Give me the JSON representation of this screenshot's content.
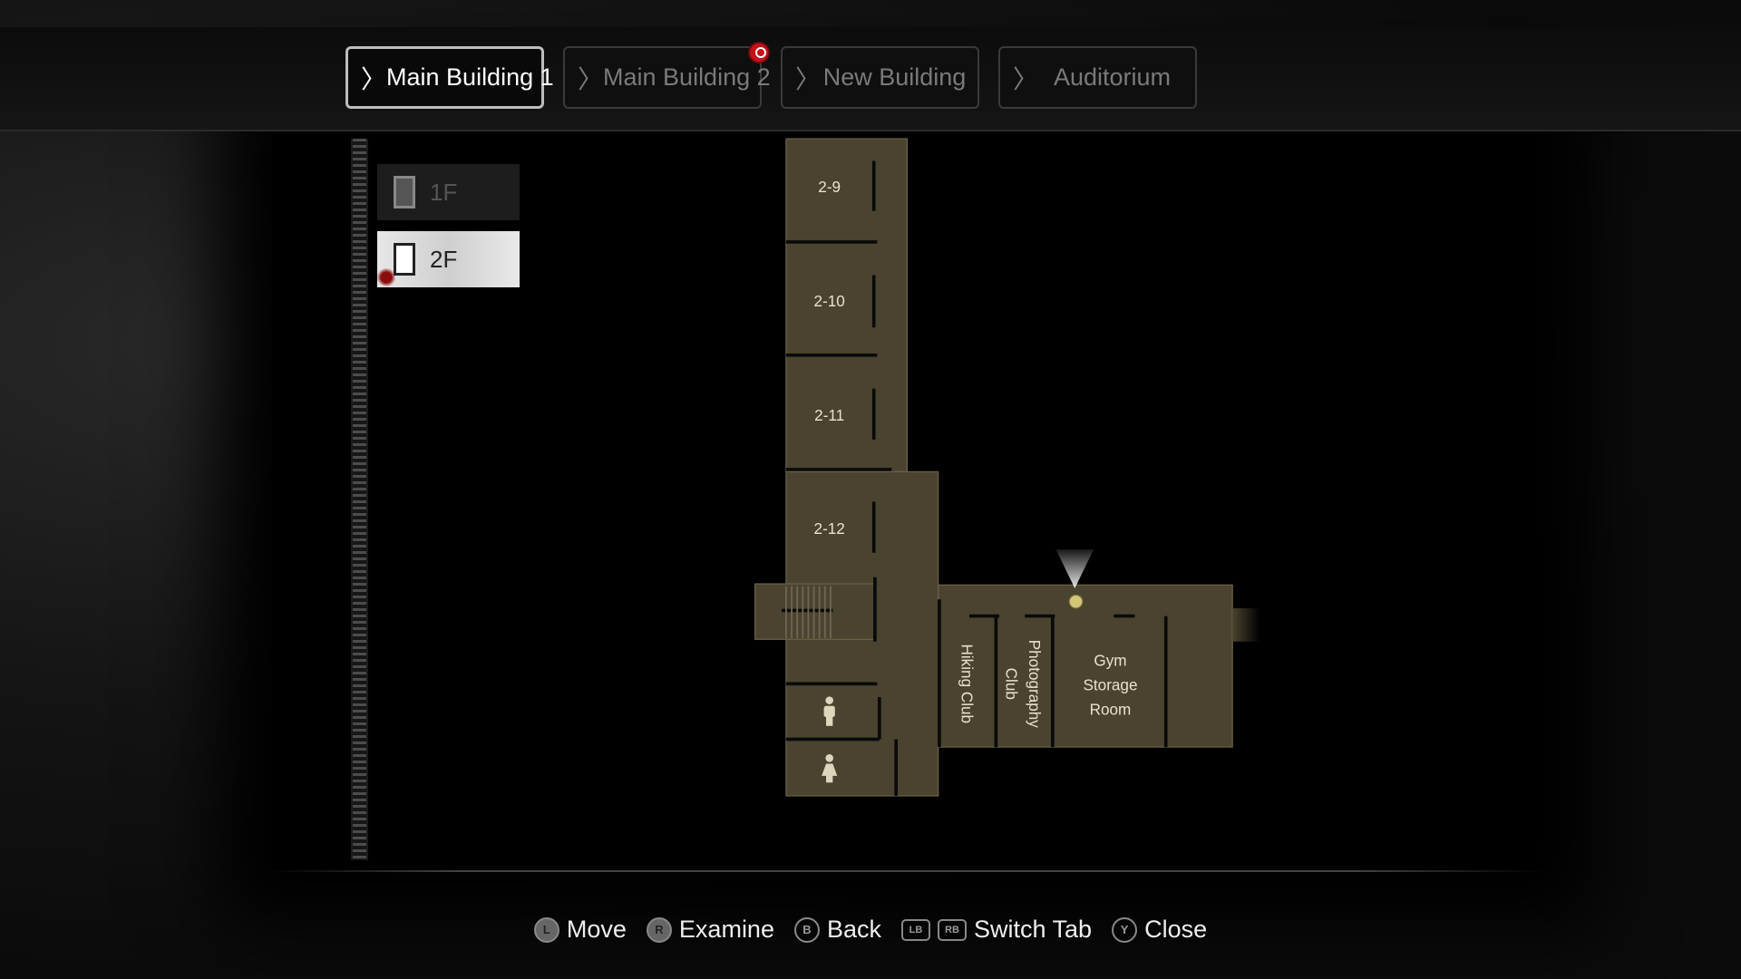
{
  "tabs": [
    {
      "label": "Main Building 1",
      "active": true
    },
    {
      "label": "Main Building 2",
      "active": false,
      "has_marker": true
    },
    {
      "label": "New Building",
      "active": false
    },
    {
      "label": "Auditorium",
      "active": false
    }
  ],
  "floors": [
    {
      "label": "1F",
      "selected": false
    },
    {
      "label": "2F",
      "selected": true
    }
  ],
  "map": {
    "rooms": [
      "2-9",
      "2-10",
      "2-11",
      "2-12",
      "Hiking Club",
      "Photography",
      "Club",
      "Gym",
      "Storage",
      "Room"
    ],
    "icons": [
      "male-restroom-icon",
      "female-restroom-icon",
      "stairs",
      "player-position-marker"
    ],
    "colors": {
      "floor": "#4a4330",
      "wall": "#0a0a0a",
      "label": "#e8e2cc",
      "marker": "#c4121a"
    }
  },
  "footer": {
    "hints": [
      {
        "button": "L",
        "label": "Move"
      },
      {
        "button": "R",
        "label": "Examine"
      },
      {
        "button": "B",
        "label": "Back"
      },
      {
        "button": "LB",
        "button2": "RB",
        "label": "Switch Tab"
      },
      {
        "button": "Y",
        "label": "Close"
      }
    ]
  }
}
